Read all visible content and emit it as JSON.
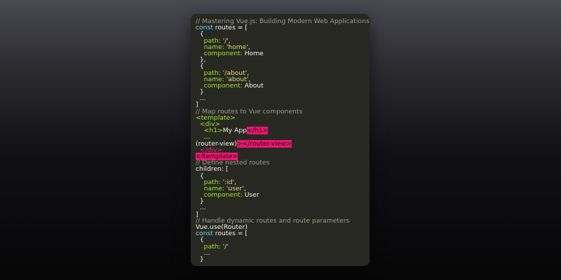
{
  "code_card": {
    "lines": [
      [
        {
          "t": "// Mastering Vue.js: Building Modern Web Applications",
          "k": "comment"
        }
      ],
      [
        {
          "t": "const",
          "k": "keyword"
        },
        {
          "t": " routes = [",
          "k": "ident"
        }
      ],
      [
        {
          "t": "  {",
          "k": "punct"
        }
      ],
      [
        {
          "t": "    path: ",
          "k": "prop"
        },
        {
          "t": "'/'",
          "k": "str"
        },
        {
          "t": ",",
          "k": "punct"
        }
      ],
      [
        {
          "t": "    name: ",
          "k": "prop"
        },
        {
          "t": "'home'",
          "k": "str"
        },
        {
          "t": ",",
          "k": "punct"
        }
      ],
      [
        {
          "t": "    component: ",
          "k": "prop"
        },
        {
          "t": "Home",
          "k": "ident"
        }
      ],
      [
        {
          "t": "  },",
          "k": "punct"
        }
      ],
      [
        {
          "t": "  {",
          "k": "punct"
        }
      ],
      [
        {
          "t": "    path: ",
          "k": "prop"
        },
        {
          "t": "'/about'",
          "k": "str"
        },
        {
          "t": ",",
          "k": "punct"
        }
      ],
      [
        {
          "t": "    name: ",
          "k": "prop"
        },
        {
          "t": "'about'",
          "k": "str"
        },
        {
          "t": ",",
          "k": "punct"
        }
      ],
      [
        {
          "t": "    component: ",
          "k": "prop"
        },
        {
          "t": "About",
          "k": "ident"
        }
      ],
      [
        {
          "t": "  }",
          "k": "punct"
        }
      ],
      [
        {
          "t": "  ...",
          "k": "punct"
        }
      ],
      [
        {
          "t": "]",
          "k": "punct"
        }
      ],
      [
        {
          "t": "// Map routes to Vue components",
          "k": "comment"
        }
      ],
      [
        {
          "t": "<template>",
          "k": "tag"
        }
      ],
      [
        {
          "t": "  <div>",
          "k": "tag"
        }
      ],
      [
        {
          "t": "    <h1>",
          "k": "tag"
        },
        {
          "t": "My App",
          "k": "ident"
        },
        {
          "t": "</h1>",
          "k": "endtag-hl"
        }
      ],
      [
        {
          "t": "    ...",
          "k": "punct"
        }
      ],
      [
        {
          "t": "(router-view)",
          "k": "ident"
        },
        {
          "t": "></router-view>",
          "k": "endtag-hl"
        }
      ],
      [
        {
          "t": "  </div>",
          "k": "endtag"
        }
      ],
      [
        {
          "t": "</template>",
          "k": "endtag-hl"
        }
      ],
      [
        {
          "t": "// Define nested routes",
          "k": "comment"
        }
      ],
      [
        {
          "t": "children: [",
          "k": "ident"
        }
      ],
      [
        {
          "t": "  {",
          "k": "punct"
        }
      ],
      [
        {
          "t": "    path: ",
          "k": "prop"
        },
        {
          "t": "':id'",
          "k": "str"
        },
        {
          "t": ",",
          "k": "punct"
        }
      ],
      [
        {
          "t": "    name: ",
          "k": "prop"
        },
        {
          "t": "'user'",
          "k": "str"
        },
        {
          "t": ",",
          "k": "punct"
        }
      ],
      [
        {
          "t": "    component: ",
          "k": "prop"
        },
        {
          "t": "User",
          "k": "ident"
        }
      ],
      [
        {
          "t": "  }",
          "k": "punct"
        }
      ],
      [
        {
          "t": "  ...",
          "k": "punct"
        }
      ],
      [
        {
          "t": "]",
          "k": "punct"
        }
      ],
      [
        {
          "t": "// Handle dynamic routes and route parameters",
          "k": "comment"
        }
      ],
      [
        {
          "t": "Vue.use(Router)",
          "k": "ident"
        }
      ],
      [
        {
          "t": "const",
          "k": "keyword"
        },
        {
          "t": " routes = [",
          "k": "ident"
        }
      ],
      [
        {
          "t": "  {",
          "k": "punct"
        }
      ],
      [
        {
          "t": "    path: ",
          "k": "prop"
        },
        {
          "t": "'/'",
          "k": "str"
        }
      ],
      [
        {
          "t": "    ...",
          "k": "punct"
        }
      ],
      [
        {
          "t": "  }",
          "k": "punct"
        }
      ],
      [
        {
          "t": "  ...",
          "k": "punct"
        }
      ],
      [
        {
          "t": "]",
          "k": "punct"
        }
      ]
    ]
  },
  "theme": {
    "background": "#272822",
    "comment": "#9e9b8c",
    "keyword": "#66d9ef",
    "string": "#e6db74",
    "property": "#a6e22e",
    "tag_close": "#f92672"
  }
}
